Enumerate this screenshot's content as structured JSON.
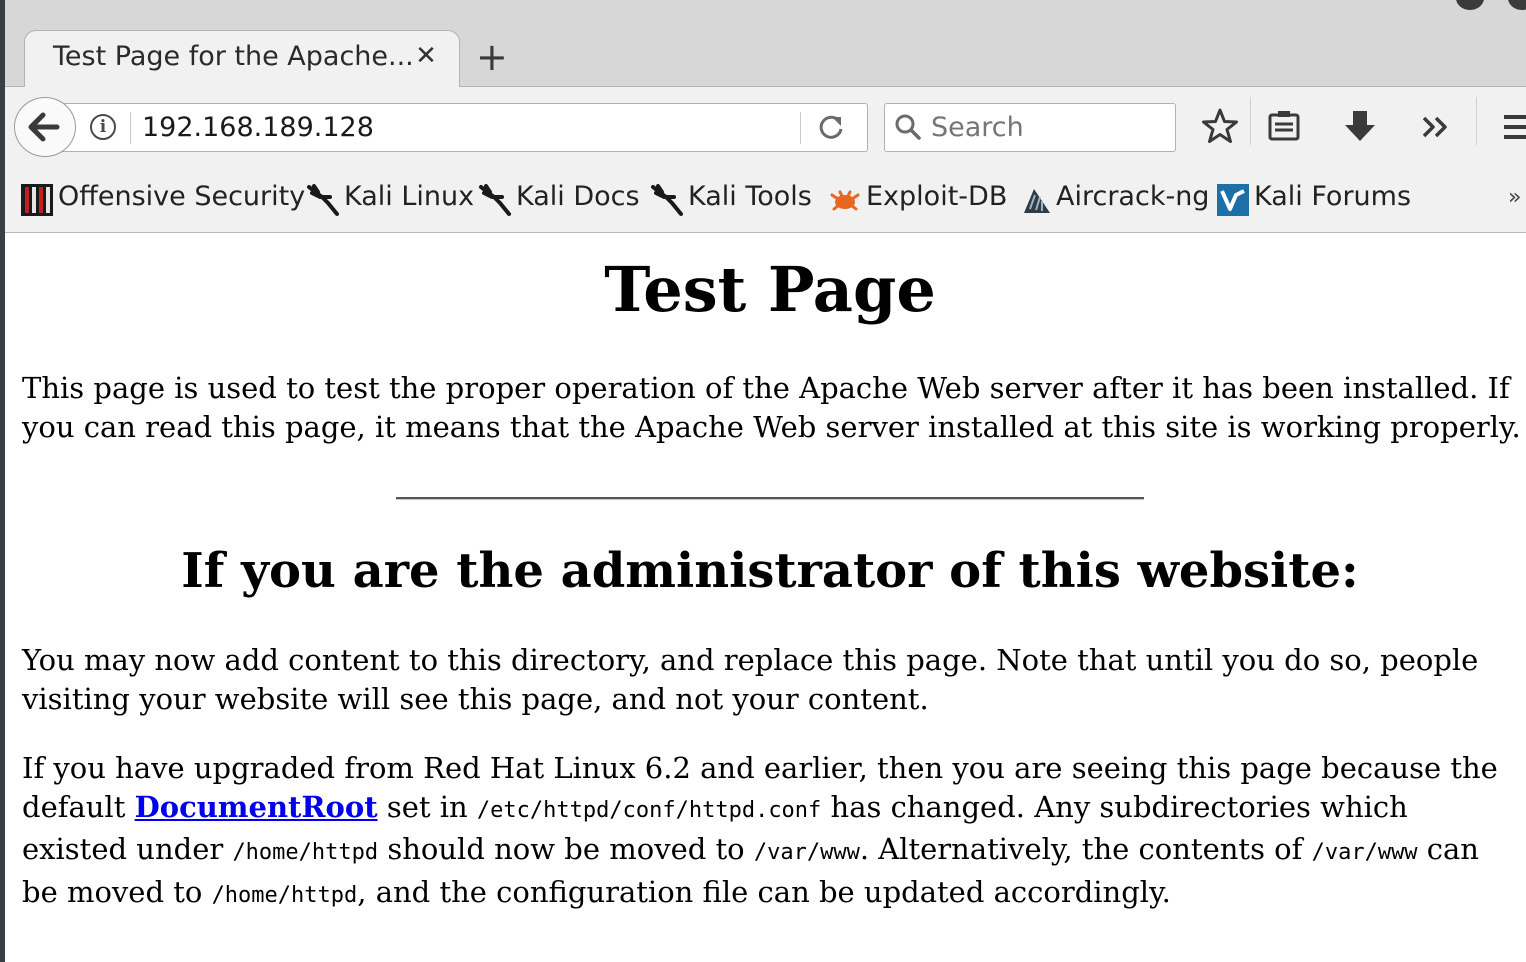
{
  "browser": {
    "tab": {
      "title": "Test Page for the Apache..."
    },
    "url": "192.168.189.128",
    "search_placeholder": "Search"
  },
  "bookmarks": [
    {
      "label": "Offensive Security",
      "icon": "offensive-security-icon"
    },
    {
      "label": "Kali Linux",
      "icon": "kali-dragon-icon"
    },
    {
      "label": "Kali Docs",
      "icon": "kali-dragon-icon"
    },
    {
      "label": "Kali Tools",
      "icon": "kali-dragon-icon"
    },
    {
      "label": "Exploit-DB",
      "icon": "exploit-db-icon"
    },
    {
      "label": "Aircrack-ng",
      "icon": "aircrack-icon"
    },
    {
      "label": "Kali Forums",
      "icon": "kali-forums-icon"
    }
  ],
  "page": {
    "title": "Test Page",
    "intro": "This page is used to test the proper operation of the Apache Web server after it has been installed. If you can read this page, it means that the Apache Web server installed at this site is working properly.",
    "admin_heading": "If you are the administrator of this website:",
    "admin_para": "You may now add content to this directory, and replace this page. Note that until you do so, people visiting your website will see this page, and not your content.",
    "upgrade": {
      "t1": "If you have upgraded from Red Hat Linux 6.2 and earlier, then you are seeing this page because the default ",
      "link": "DocumentRoot",
      "t2": " set in ",
      "path_conf": "/etc/httpd/conf/httpd.conf",
      "t3": " has changed. Any subdirectories which existed under ",
      "path_home1": "/home/httpd",
      "t4": " should now be moved to ",
      "path_var1": "/var/www",
      "t5": ". Alternatively, the contents of ",
      "path_var2": "/var/www",
      "t6": " can be moved to ",
      "path_home2": "/home/httpd",
      "t7": ", and the configuration file can be updated accordingly."
    }
  }
}
